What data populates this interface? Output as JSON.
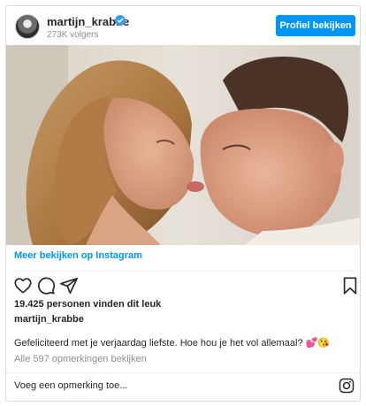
{
  "header": {
    "username": "martijn_krabbe",
    "followers": "273K volgers",
    "profile_button": "Profiel bekijken",
    "verified_icon": "verified-badge-icon"
  },
  "post": {
    "image_alt": "Foto",
    "more_link": "Meer bekijken op Instagram",
    "likes": "19.425 personen vinden dit leuk",
    "owner": "martijn_krabbe",
    "caption": "Gefeliciteerd met je verjaardag liefste. Hoe hou je het vol allemaal? 💕😘",
    "comments_link": "Alle 597 opmerkingen bekijken"
  },
  "comment": {
    "placeholder": "Voeg een opmerking toe..."
  },
  "icons": {
    "like": "heart-icon",
    "comment": "comment-icon",
    "share": "share-icon",
    "save": "bookmark-icon",
    "instagram": "instagram-logo-icon"
  },
  "colors": {
    "accent": "#0095f6",
    "border": "#dbdbdb",
    "muted": "#8e8e8e"
  }
}
